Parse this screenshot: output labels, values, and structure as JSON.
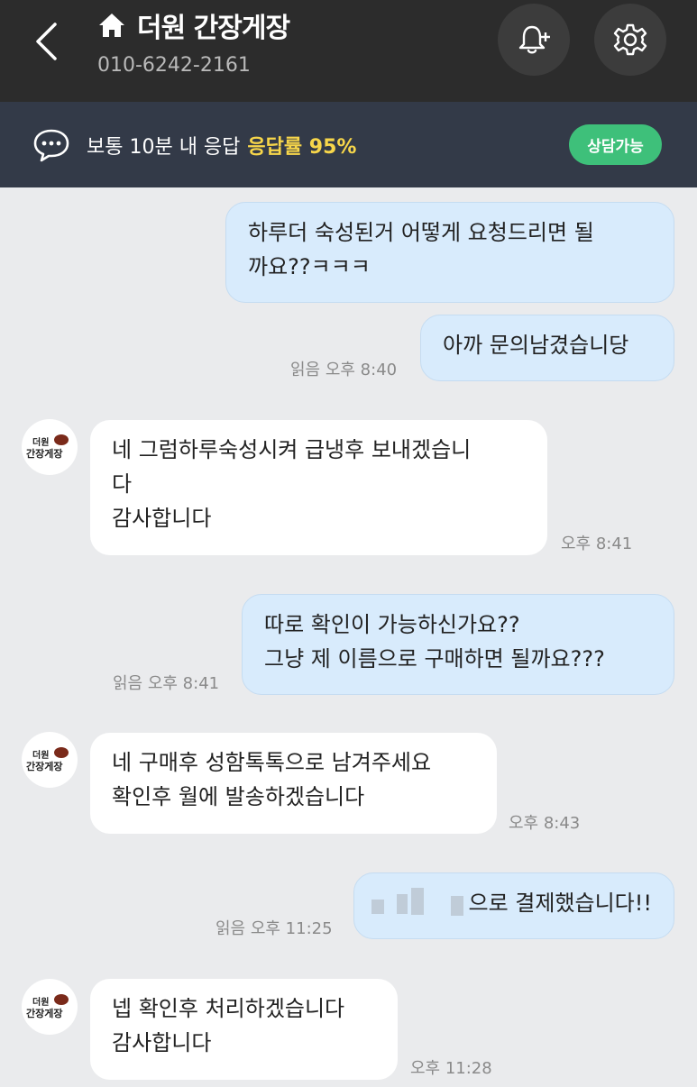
{
  "header": {
    "title": "더원 간장게장",
    "phone": "010-6242-2161"
  },
  "info": {
    "response": "보통 10분 내 응답",
    "rate": "응답률 95%",
    "status": "상담가능"
  },
  "avatar": {
    "line1": "더원",
    "line2": "간장게장"
  },
  "messages": [
    {
      "lines": [
        "하루더 숙성된거 어떻게 요청드리면 될",
        "까요??ㅋㅋㅋ"
      ]
    },
    {
      "lines": [
        "아까 문의남겼습니당"
      ],
      "meta": "읽음 오후 8:40"
    },
    {
      "lines": [
        "네 그럼하루숙성시켜 급냉후 보내겠습니",
        "다",
        "감사합니다"
      ],
      "meta": "오후 8:41"
    },
    {
      "lines": [
        "따로 확인이 가능하신가요??",
        "그냥 제 이름으로 구매하면 될까요???"
      ],
      "meta": "읽음 오후 8:41"
    },
    {
      "lines": [
        "네 구매후 성함톡톡으로 남겨주세요",
        "확인후 월에 발송하겠습니다"
      ],
      "meta": "오후 8:43"
    },
    {
      "lines": [
        "으로 결제했습니다!!"
      ],
      "meta": "읽음 오후 11:25"
    },
    {
      "lines": [
        "넵 확인후 처리하겠습니다",
        "감사합니다"
      ],
      "meta": "오후 11:28"
    }
  ]
}
